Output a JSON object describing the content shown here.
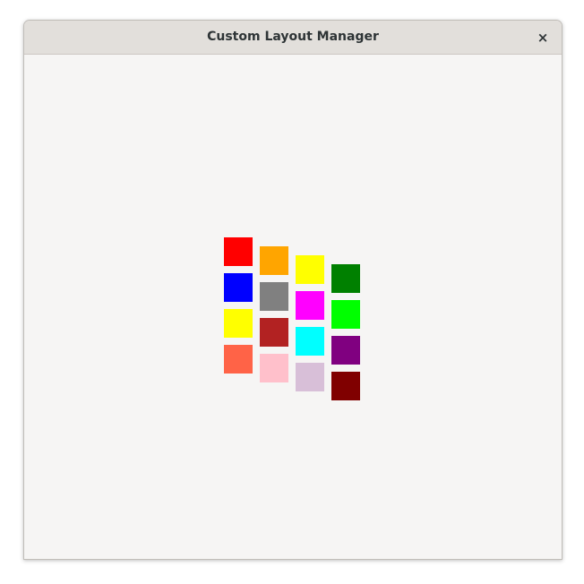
{
  "window": {
    "title": "Custom Layout Manager",
    "close_icon": "close-icon",
    "close_glyph": "×"
  },
  "swatches": [
    {
      "id": "red",
      "color": "#ff0000"
    },
    {
      "id": "blue",
      "color": "#0000ff"
    },
    {
      "id": "yellow",
      "color": "#ffff00"
    },
    {
      "id": "tomato",
      "color": "#ff6347"
    },
    {
      "id": "orange",
      "color": "#ffa500"
    },
    {
      "id": "gray",
      "color": "#808080"
    },
    {
      "id": "firebrick",
      "color": "#b22222"
    },
    {
      "id": "pink",
      "color": "#ffc0cb"
    },
    {
      "id": "yellow-2",
      "color": "#ffff00"
    },
    {
      "id": "magenta",
      "color": "#ff00ff"
    },
    {
      "id": "cyan",
      "color": "#00ffff"
    },
    {
      "id": "thistle",
      "color": "#d8bfd8"
    },
    {
      "id": "green",
      "color": "#008000"
    },
    {
      "id": "lime",
      "color": "#00ff00"
    },
    {
      "id": "purple",
      "color": "#800080"
    },
    {
      "id": "maroon",
      "color": "#800000"
    }
  ]
}
